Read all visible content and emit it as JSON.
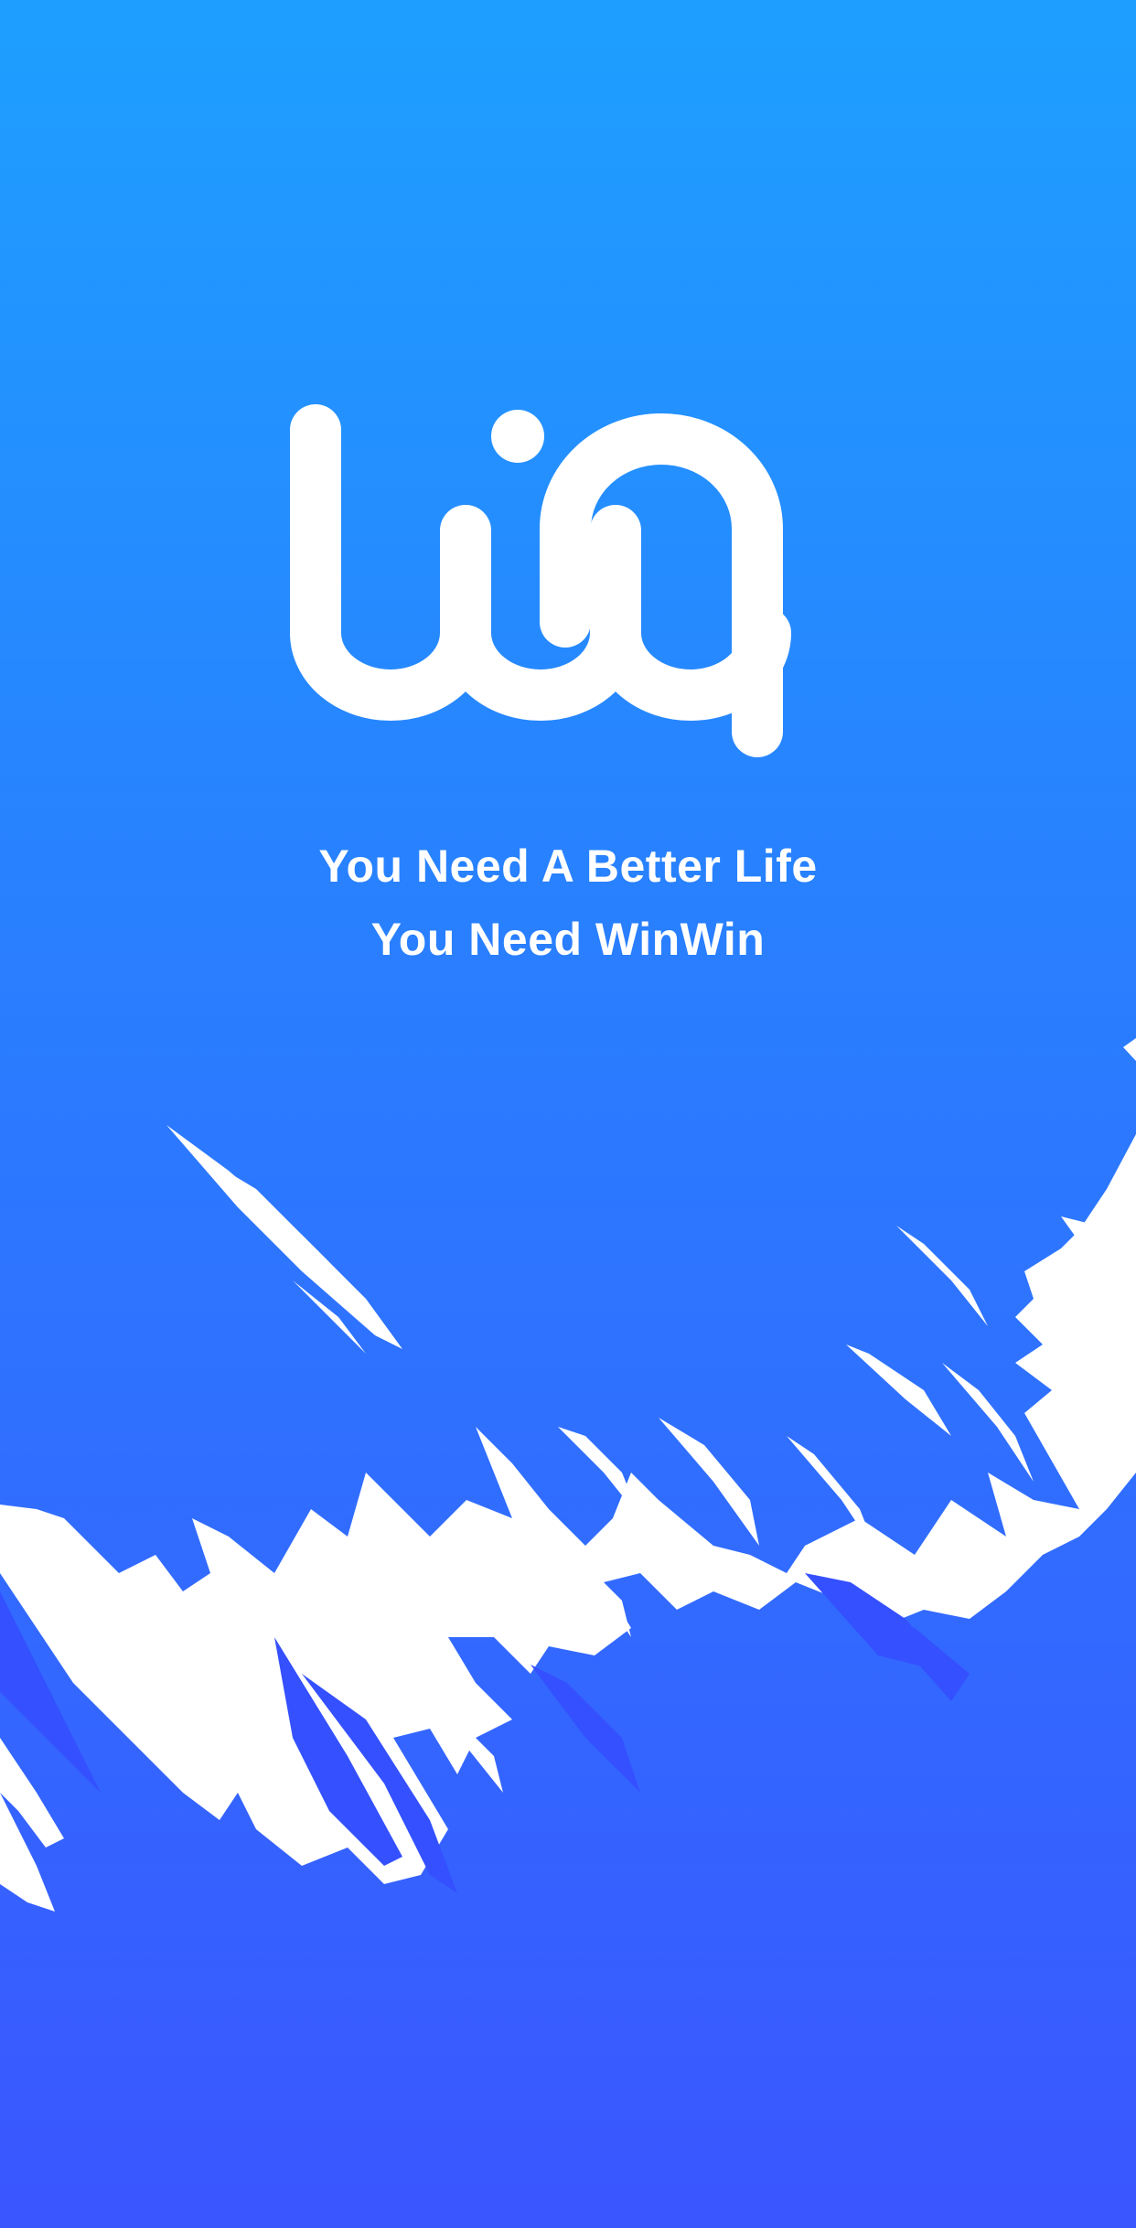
{
  "app": {
    "name": "WinWin",
    "logo_icon": "winwin-logo-icon"
  },
  "tagline": {
    "line1": "You Need A Better Life",
    "line2": "You Need WinWin"
  },
  "colors": {
    "gradient_top": "#1E9FFF",
    "gradient_bottom": "#3A5BFF",
    "logo": "#FFFFFF",
    "text": "#FFFFFF",
    "background": "#FFFFFF"
  }
}
